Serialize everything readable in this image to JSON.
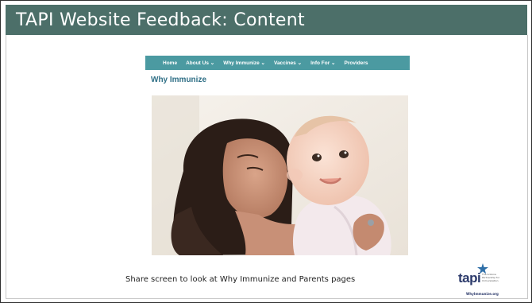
{
  "slide": {
    "title": "TAPI Website Feedback: Content",
    "caption": "Share screen to look at Why Immunize and Parents pages"
  },
  "website": {
    "nav": [
      {
        "label": "Home"
      },
      {
        "label": "About Us ⌄"
      },
      {
        "label": "Why Immunize ⌄"
      },
      {
        "label": "Vaccines ⌄"
      },
      {
        "label": "Info For ⌄"
      },
      {
        "label": "Providers"
      }
    ],
    "heading": "Why Immunize"
  },
  "logo": {
    "word": "tapi",
    "tagline": "The Arizona Partnership for Immunization",
    "url": "WhyImmunize.org"
  },
  "colors": {
    "title_bar": "#4c6f69",
    "nav_bar": "#4b9aa1",
    "heading": "#2f6f86",
    "logo_text": "#2c3a6b"
  }
}
